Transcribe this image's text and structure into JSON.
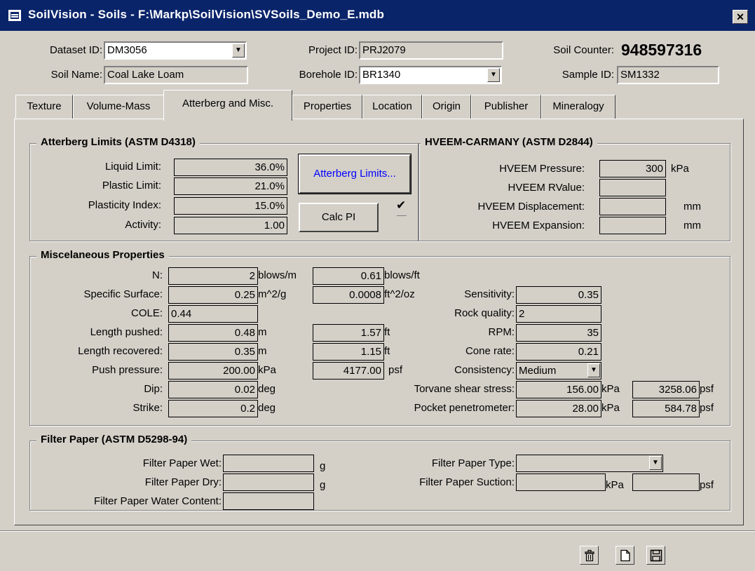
{
  "window": {
    "title": "SoilVision - Soils - F:\\Markp\\SoilVision\\SVSoils_Demo_E.mdb",
    "close": "✕"
  },
  "header": {
    "dataset_label": "Dataset ID:",
    "dataset_value": "DM3056",
    "soilname_label": "Soil Name:",
    "soilname_value": "Coal Lake Loam",
    "project_label": "Project ID:",
    "project_value": "PRJ2079",
    "borehole_label": "Borehole ID:",
    "borehole_value": "BR1340",
    "counter_label": "Soil Counter:",
    "counter_value": "948597316",
    "sample_label": "Sample ID:",
    "sample_value": "SM1332"
  },
  "tabs": [
    "Texture",
    "Volume-Mass",
    "Atterberg and Misc.",
    "Properties",
    "Location",
    "Origin",
    "Publisher",
    "Mineralogy"
  ],
  "atterberg": {
    "title": "Atterberg Limits (ASTM D4318)",
    "liquid_label": "Liquid Limit:",
    "liquid_value": "36.0%",
    "plastic_label": "Plastic Limit:",
    "plastic_value": "21.0%",
    "pi_label": "Plasticity Index:",
    "pi_value": "15.0%",
    "activity_label": "Activity:",
    "activity_value": "1.00",
    "limits_button": "Atterberg Limits...",
    "calc_button": "Calc PI",
    "check": "✔"
  },
  "hveem": {
    "title": "HVEEM-CARMANY (ASTM D2844)",
    "pressure_label": "HVEEM Pressure:",
    "pressure_value": "300",
    "pressure_unit": "kPa",
    "rvalue_label": "HVEEM RValue:",
    "rvalue_value": "",
    "disp_label": "HVEEM Displacement:",
    "disp_value": "",
    "disp_unit": "mm",
    "exp_label": "HVEEM Expansion:",
    "exp_value": "",
    "exp_unit": "mm"
  },
  "misc": {
    "title": "Miscelaneous Properties",
    "n_label": "N:",
    "n_value": "2",
    "n_unit": "blows/m",
    "n_value2": "0.61",
    "n_unit2": "blows/ft",
    "ss_label": "Specific Surface:",
    "ss_value": "0.25",
    "ss_unit": "m^2/g",
    "ss_value2": "0.0008",
    "ss_unit2": "ft^2/oz",
    "cole_label": "COLE:",
    "cole_value": "0.44",
    "lp_label": "Length pushed:",
    "lp_value": "0.48",
    "lp_unit": "m",
    "lp_value2": "1.57",
    "lp_unit2": "ft",
    "lr_label": "Length recovered:",
    "lr_value": "0.35",
    "lr_unit": "m",
    "lr_value2": "1.15",
    "lr_unit2": "ft",
    "pp_label": "Push pressure:",
    "pp_value": "200.00",
    "pp_unit": "kPa",
    "pp_value2": "4177.00",
    "pp_unit2": "psf",
    "dip_label": "Dip:",
    "dip_value": "0.02",
    "dip_unit": "deg",
    "strike_label": "Strike:",
    "strike_value": "0.2",
    "strike_unit": "deg",
    "sens_label": "Sensitivity:",
    "sens_value": "0.35",
    "rq_label": "Rock quality:",
    "rq_value": "2",
    "rpm_label": "RPM:",
    "rpm_value": "35",
    "cone_label": "Cone rate:",
    "cone_value": "0.21",
    "cons_label": "Consistency:",
    "cons_value": "Medium",
    "tv_label": "Torvane shear stress:",
    "tv_value": "156.00",
    "tv_unit": "kPa",
    "tv_value2": "3258.06",
    "tv_unit2": "psf",
    "pen_label": "Pocket penetrometer:",
    "pen_value": "28.00",
    "pen_unit": "kPa",
    "pen_value2": "584.78",
    "pen_unit2": "psf"
  },
  "filter": {
    "title": "Filter Paper (ASTM D5298-94)",
    "wet_label": "Filter Paper Wet:",
    "wet_value": "",
    "wet_unit": "g",
    "dry_label": "Filter Paper Dry:",
    "dry_value": "",
    "dry_unit": "g",
    "wc_label": "Filter Paper Water Content:",
    "wc_value": "",
    "type_label": "Filter Paper Type:",
    "type_value": "",
    "suction_label": "Filter Paper Suction:",
    "suction_value": "",
    "suction_unit": "kPa",
    "suction_value2": "",
    "suction_unit2": "psf"
  },
  "toolbar": {
    "icons": [
      "trash-icon",
      "new-document-icon",
      "save-icon"
    ]
  }
}
